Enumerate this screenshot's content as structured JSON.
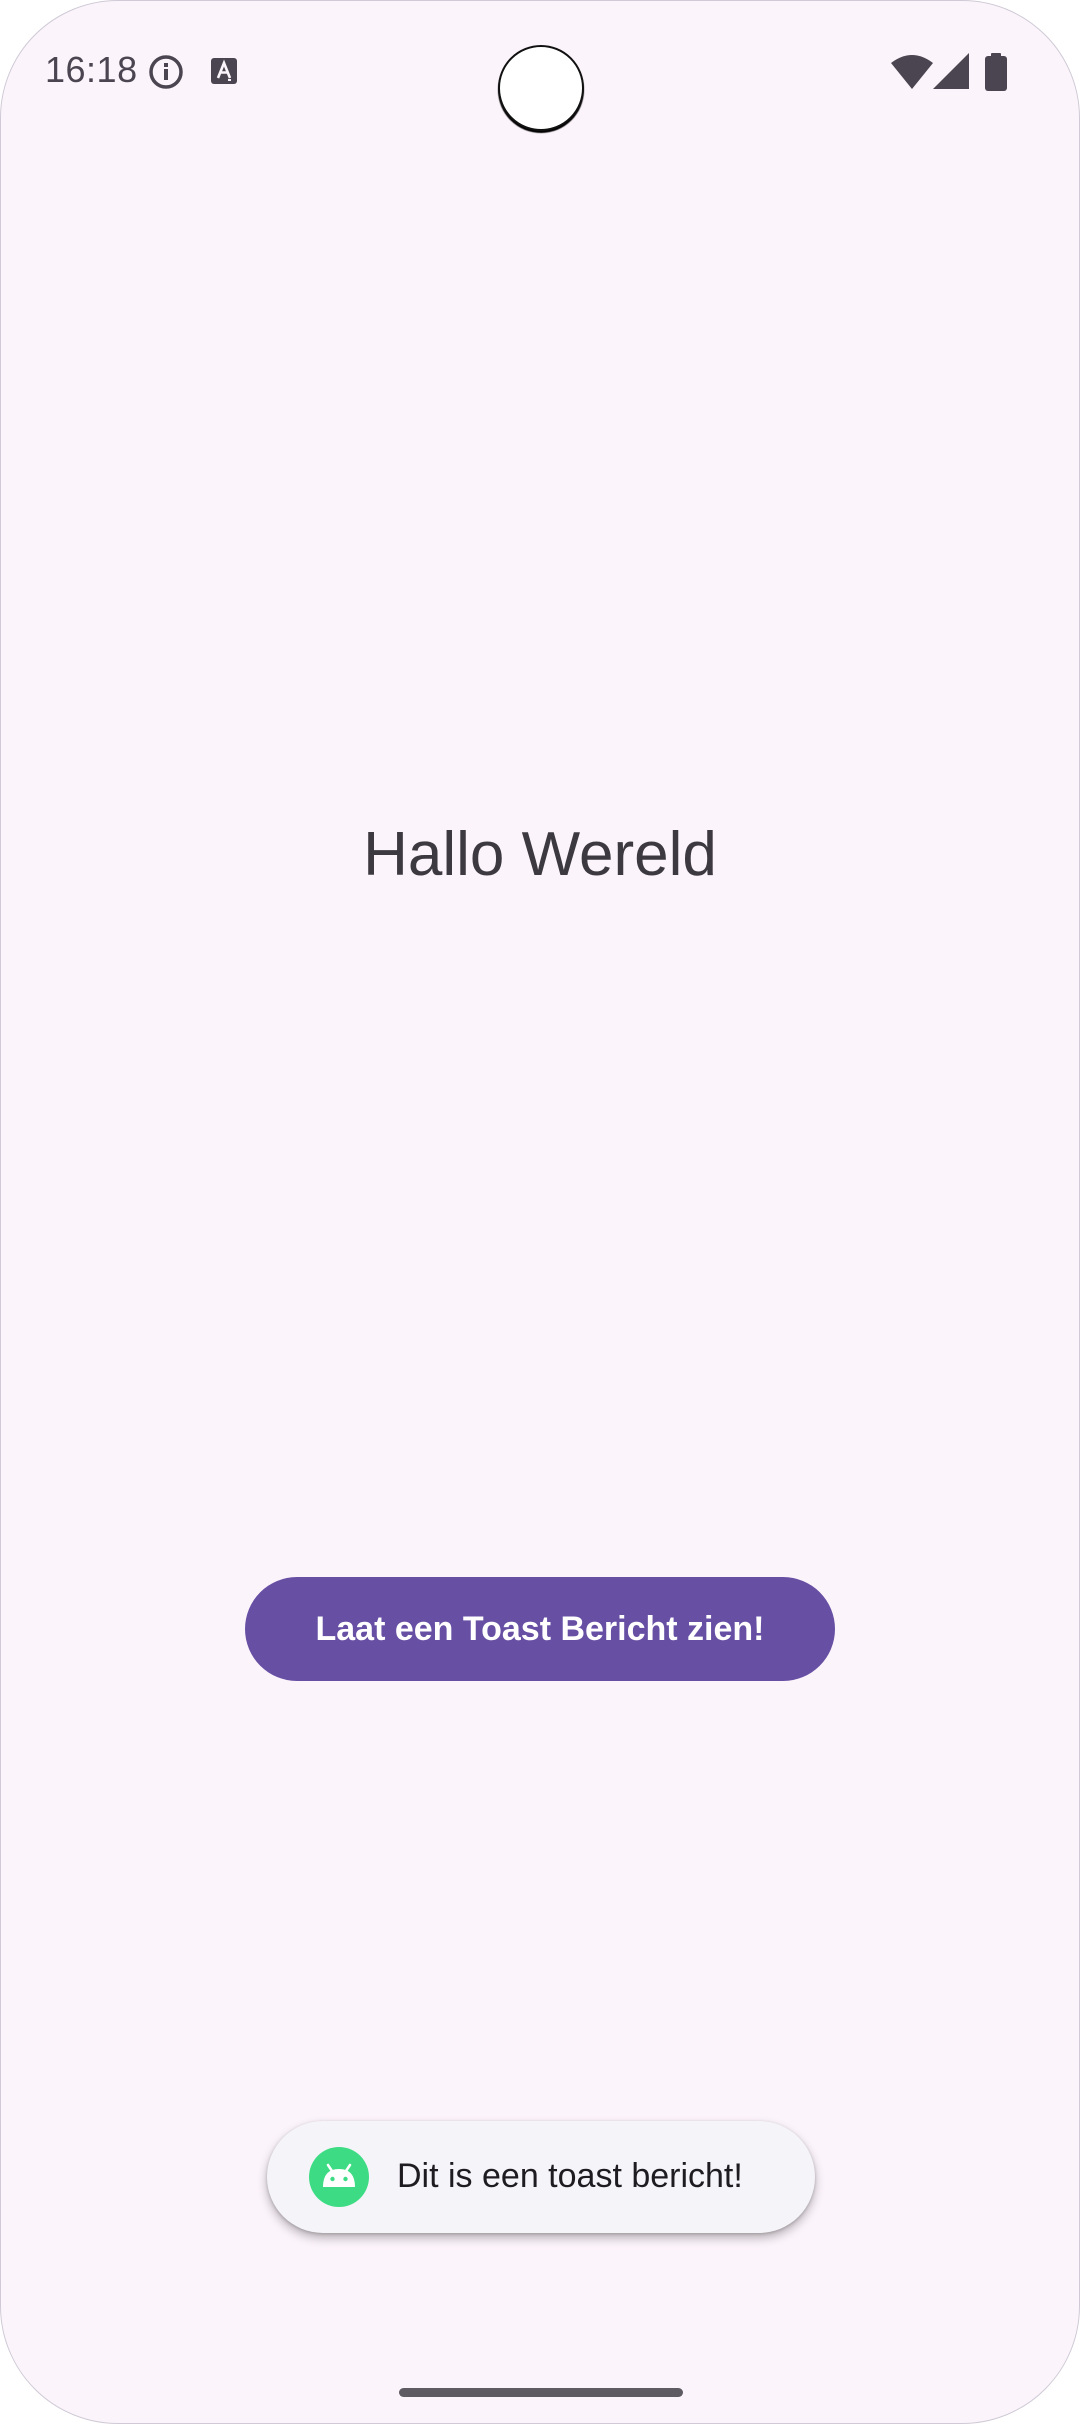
{
  "status_bar": {
    "time": "16:18",
    "icons": [
      "info-icon",
      "accessibility-font-icon",
      "wifi-icon",
      "cellular-signal-icon",
      "battery-icon"
    ]
  },
  "main": {
    "greeting": "Hallo Wereld",
    "button_label": "Laat een Toast Bericht zien!"
  },
  "toast": {
    "icon": "android-icon",
    "message": "Dit is een toast bericht!"
  },
  "colors": {
    "background": "#fcf4fb",
    "button": "#6750a4",
    "button_text": "#ffffff",
    "toast_background": "#f5f4f9",
    "android_green": "#3ddc84"
  }
}
